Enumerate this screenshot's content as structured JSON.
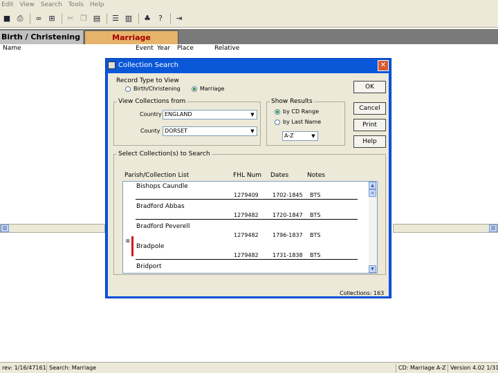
{
  "menubar": {
    "items": [
      "Edit",
      "View",
      "Search",
      "Tools",
      "Help"
    ]
  },
  "toolbar": {
    "icons": [
      "save-icon",
      "print-icon",
      "binoculars-icon",
      "search-options-icon",
      "cut-icon",
      "copy-icon",
      "paste-icon",
      "list-view-icon",
      "book-icon",
      "family-tree-icon",
      "help-pointer-icon",
      "exit-icon"
    ]
  },
  "tabs": {
    "birth": "Birth / Christening",
    "marriage": "Marriage"
  },
  "columns": {
    "name": "Name",
    "event": "Event",
    "year": "Year",
    "place": "Place",
    "relative": "Relative"
  },
  "dialog": {
    "title": "Collection Search",
    "close": "✕",
    "record_type": {
      "label": "Record Type to View",
      "option_birth": "Birth/Christening",
      "option_marriage": "Marriage",
      "selected": "Marriage"
    },
    "view_from": {
      "label": "View Collections from",
      "country_label": "Country",
      "country_value": "ENGLAND",
      "county_label": "County",
      "county_value": "DORSET"
    },
    "show_results": {
      "label": "Show Results",
      "option_cd": "by CD Range",
      "option_name": "by Last Name",
      "selected": "by CD Range",
      "sort_value": "A-Z"
    },
    "buttons": {
      "ok": "OK",
      "cancel": "Cancel",
      "print": "Print",
      "help": "Help"
    },
    "select_label": "Select Collection(s) to Search",
    "list_headers": {
      "parish": "Parish/Collection List",
      "fhl": "FHL Num",
      "dates": "Dates",
      "notes": "Notes"
    },
    "rows": [
      {
        "name": "Bishops Caundle",
        "fhl": "1279409",
        "dates": "1702-1845",
        "notes": "BTS"
      },
      {
        "name": "Bradford Abbas",
        "fhl": "1279482",
        "dates": "1720-1847",
        "notes": "BTS"
      },
      {
        "name": "Bradford Peverell",
        "fhl": "1279482",
        "dates": "1796-1837",
        "notes": "BTS"
      },
      {
        "name": "Bradpole",
        "fhl": "1279482",
        "dates": "1731-1838",
        "notes": "BTS"
      },
      {
        "name": "Bridport",
        "fhl": "",
        "dates": "",
        "notes": ""
      }
    ],
    "collections_count": "Collections: 163"
  },
  "status": {
    "rev": "rev: 1/16/47161",
    "search": "Search: Marriage",
    "cd": "CD: Marriage A-Z",
    "version": "Version 4.02 1/31/..."
  }
}
